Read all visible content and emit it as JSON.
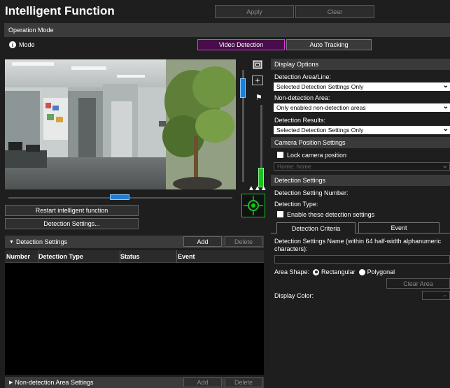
{
  "header": {
    "title": "Intelligent Function",
    "apply_label": "Apply",
    "clear_label": "Clear"
  },
  "operation_mode": {
    "section_label": "Operation Mode",
    "mode_label": "Mode",
    "video_detection_label": "Video Detection",
    "auto_tracking_label": "Auto Tracking"
  },
  "controls": {
    "restart_label": "Restart intelligent function",
    "detection_settings_button": "Detection Settings..."
  },
  "detection_settings_list": {
    "title": "Detection Settings",
    "add_label": "Add",
    "delete_label": "Delete",
    "columns": [
      "Number",
      "Detection Type",
      "Status",
      "Event"
    ]
  },
  "non_detection_list": {
    "title": "Non-detection Area Settings",
    "add_label": "Add",
    "delete_label": "Delete"
  },
  "display_options": {
    "title": "Display Options",
    "area_line_label": "Detection Area/Line:",
    "area_line_value": "Selected Detection Settings Only",
    "non_detection_label": "Non-detection Area:",
    "non_detection_value": "Only enabled non-detection areas",
    "results_label": "Detection Results:",
    "results_value": "Selected Detection Settings Only"
  },
  "camera_position": {
    "title": "Camera Position Settings",
    "lock_label": "Lock camera position",
    "lock_checked": false,
    "home_value": "Home: home"
  },
  "detection_settings_form": {
    "title": "Detection Settings",
    "number_label": "Detection Setting Number:",
    "type_label": "Detection Type:",
    "enable_label": "Enable these detection settings",
    "enable_checked": false,
    "tab_criteria": "Detection Criteria",
    "tab_event": "Event",
    "name_label": "Detection Settings Name (within 64 half-width alphanumeric characters):",
    "name_value": "",
    "area_shape_label": "Area Shape:",
    "shape_rect": "Rectangular",
    "shape_poly": "Polygonal",
    "shape_selected": "Rectangular",
    "clear_area_label": "Clear Area",
    "display_color_label": "Display Color:"
  },
  "colors": {
    "accent_green": "#19c221",
    "accent_blue": "#1e7fd8",
    "active_mode_border": "#c22bd0"
  }
}
